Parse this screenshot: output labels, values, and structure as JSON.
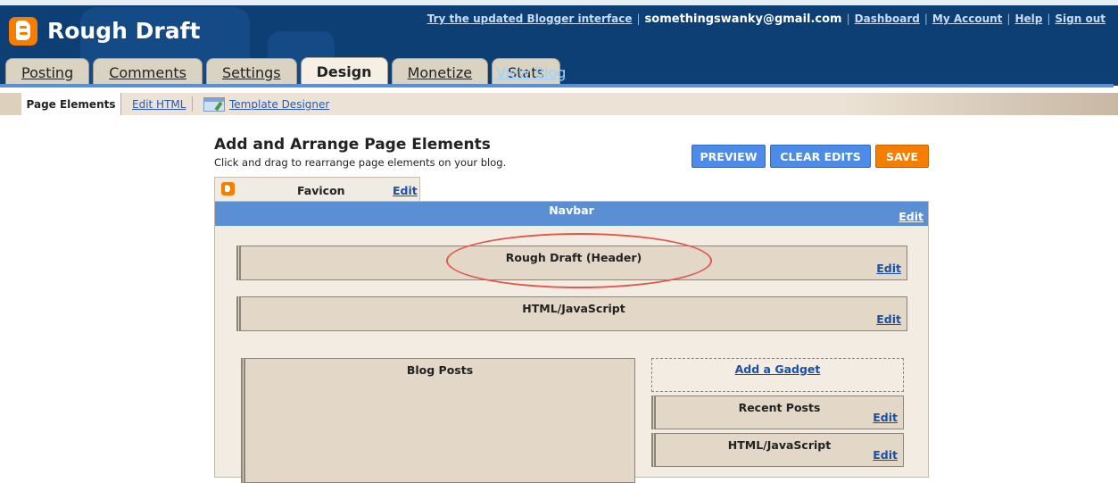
{
  "header": {
    "blog_title": "Rough Draft",
    "links": {
      "updated_interface": "Try the updated Blogger interface",
      "email": "somethingswanky@gmail.com",
      "dashboard": "Dashboard",
      "my_account": "My Account",
      "help": "Help",
      "sign_out": "Sign out"
    },
    "tabs": [
      {
        "label": "Posting",
        "active": false
      },
      {
        "label": "Comments",
        "active": false
      },
      {
        "label": "Settings",
        "active": false
      },
      {
        "label": "Design",
        "active": true
      },
      {
        "label": "Monetize",
        "active": false
      },
      {
        "label": "Stats",
        "active": false
      }
    ],
    "view_blog": "View Blog"
  },
  "subnav": {
    "page_elements": "Page Elements",
    "edit_html": "Edit HTML",
    "template_designer": "Template Designer"
  },
  "main": {
    "heading": "Add and Arrange Page Elements",
    "subheading": "Click and drag to rearrange page elements on your blog.",
    "buttons": {
      "preview": "PREVIEW",
      "clear_edits": "CLEAR EDITS",
      "save": "SAVE"
    },
    "favicon": {
      "label": "Favicon",
      "edit": "Edit"
    },
    "navbar": {
      "label": "Navbar",
      "edit": "Edit"
    },
    "header_widget": {
      "label": "Rough Draft (Header)",
      "edit": "Edit"
    },
    "html_js_top": {
      "label": "HTML/JavaScript",
      "edit": "Edit"
    },
    "blog_posts": {
      "label": "Blog Posts"
    },
    "add_gadget": "Add a Gadget",
    "recent_posts": {
      "label": "Recent Posts",
      "edit": "Edit"
    },
    "html_js_side": {
      "label": "HTML/JavaScript",
      "edit": "Edit"
    }
  },
  "colors": {
    "header_bg": "#0d3e74",
    "accent_blue": "#5b8fd3",
    "save_orange": "#f57d00",
    "highlight_red": "#e2574c"
  }
}
